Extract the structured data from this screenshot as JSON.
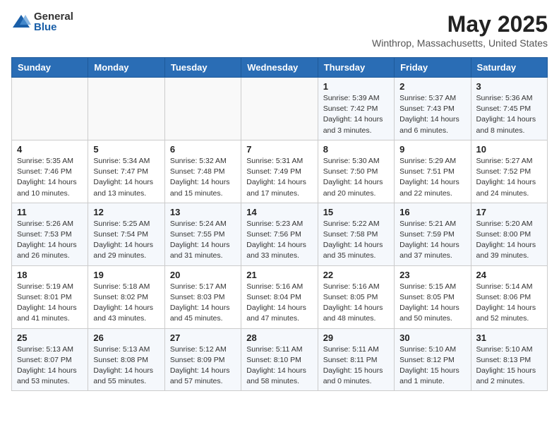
{
  "logo": {
    "general": "General",
    "blue": "Blue"
  },
  "title": "May 2025",
  "subtitle": "Winthrop, Massachusetts, United States",
  "weekdays": [
    "Sunday",
    "Monday",
    "Tuesday",
    "Wednesday",
    "Thursday",
    "Friday",
    "Saturday"
  ],
  "weeks": [
    [
      {
        "day": "",
        "info": ""
      },
      {
        "day": "",
        "info": ""
      },
      {
        "day": "",
        "info": ""
      },
      {
        "day": "",
        "info": ""
      },
      {
        "day": "1",
        "info": "Sunrise: 5:39 AM\nSunset: 7:42 PM\nDaylight: 14 hours\nand 3 minutes."
      },
      {
        "day": "2",
        "info": "Sunrise: 5:37 AM\nSunset: 7:43 PM\nDaylight: 14 hours\nand 6 minutes."
      },
      {
        "day": "3",
        "info": "Sunrise: 5:36 AM\nSunset: 7:45 PM\nDaylight: 14 hours\nand 8 minutes."
      }
    ],
    [
      {
        "day": "4",
        "info": "Sunrise: 5:35 AM\nSunset: 7:46 PM\nDaylight: 14 hours\nand 10 minutes."
      },
      {
        "day": "5",
        "info": "Sunrise: 5:34 AM\nSunset: 7:47 PM\nDaylight: 14 hours\nand 13 minutes."
      },
      {
        "day": "6",
        "info": "Sunrise: 5:32 AM\nSunset: 7:48 PM\nDaylight: 14 hours\nand 15 minutes."
      },
      {
        "day": "7",
        "info": "Sunrise: 5:31 AM\nSunset: 7:49 PM\nDaylight: 14 hours\nand 17 minutes."
      },
      {
        "day": "8",
        "info": "Sunrise: 5:30 AM\nSunset: 7:50 PM\nDaylight: 14 hours\nand 20 minutes."
      },
      {
        "day": "9",
        "info": "Sunrise: 5:29 AM\nSunset: 7:51 PM\nDaylight: 14 hours\nand 22 minutes."
      },
      {
        "day": "10",
        "info": "Sunrise: 5:27 AM\nSunset: 7:52 PM\nDaylight: 14 hours\nand 24 minutes."
      }
    ],
    [
      {
        "day": "11",
        "info": "Sunrise: 5:26 AM\nSunset: 7:53 PM\nDaylight: 14 hours\nand 26 minutes."
      },
      {
        "day": "12",
        "info": "Sunrise: 5:25 AM\nSunset: 7:54 PM\nDaylight: 14 hours\nand 29 minutes."
      },
      {
        "day": "13",
        "info": "Sunrise: 5:24 AM\nSunset: 7:55 PM\nDaylight: 14 hours\nand 31 minutes."
      },
      {
        "day": "14",
        "info": "Sunrise: 5:23 AM\nSunset: 7:56 PM\nDaylight: 14 hours\nand 33 minutes."
      },
      {
        "day": "15",
        "info": "Sunrise: 5:22 AM\nSunset: 7:58 PM\nDaylight: 14 hours\nand 35 minutes."
      },
      {
        "day": "16",
        "info": "Sunrise: 5:21 AM\nSunset: 7:59 PM\nDaylight: 14 hours\nand 37 minutes."
      },
      {
        "day": "17",
        "info": "Sunrise: 5:20 AM\nSunset: 8:00 PM\nDaylight: 14 hours\nand 39 minutes."
      }
    ],
    [
      {
        "day": "18",
        "info": "Sunrise: 5:19 AM\nSunset: 8:01 PM\nDaylight: 14 hours\nand 41 minutes."
      },
      {
        "day": "19",
        "info": "Sunrise: 5:18 AM\nSunset: 8:02 PM\nDaylight: 14 hours\nand 43 minutes."
      },
      {
        "day": "20",
        "info": "Sunrise: 5:17 AM\nSunset: 8:03 PM\nDaylight: 14 hours\nand 45 minutes."
      },
      {
        "day": "21",
        "info": "Sunrise: 5:16 AM\nSunset: 8:04 PM\nDaylight: 14 hours\nand 47 minutes."
      },
      {
        "day": "22",
        "info": "Sunrise: 5:16 AM\nSunset: 8:05 PM\nDaylight: 14 hours\nand 48 minutes."
      },
      {
        "day": "23",
        "info": "Sunrise: 5:15 AM\nSunset: 8:05 PM\nDaylight: 14 hours\nand 50 minutes."
      },
      {
        "day": "24",
        "info": "Sunrise: 5:14 AM\nSunset: 8:06 PM\nDaylight: 14 hours\nand 52 minutes."
      }
    ],
    [
      {
        "day": "25",
        "info": "Sunrise: 5:13 AM\nSunset: 8:07 PM\nDaylight: 14 hours\nand 53 minutes."
      },
      {
        "day": "26",
        "info": "Sunrise: 5:13 AM\nSunset: 8:08 PM\nDaylight: 14 hours\nand 55 minutes."
      },
      {
        "day": "27",
        "info": "Sunrise: 5:12 AM\nSunset: 8:09 PM\nDaylight: 14 hours\nand 57 minutes."
      },
      {
        "day": "28",
        "info": "Sunrise: 5:11 AM\nSunset: 8:10 PM\nDaylight: 14 hours\nand 58 minutes."
      },
      {
        "day": "29",
        "info": "Sunrise: 5:11 AM\nSunset: 8:11 PM\nDaylight: 15 hours\nand 0 minutes."
      },
      {
        "day": "30",
        "info": "Sunrise: 5:10 AM\nSunset: 8:12 PM\nDaylight: 15 hours\nand 1 minute."
      },
      {
        "day": "31",
        "info": "Sunrise: 5:10 AM\nSunset: 8:13 PM\nDaylight: 15 hours\nand 2 minutes."
      }
    ]
  ]
}
